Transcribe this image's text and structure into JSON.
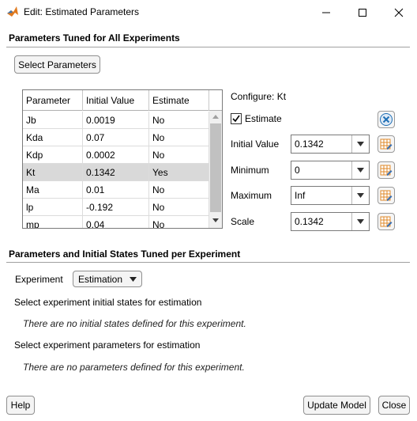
{
  "window": {
    "title": "Edit: Estimated Parameters"
  },
  "section1": {
    "title": "Parameters Tuned for All Experiments",
    "select_button": "Select Parameters",
    "table": {
      "headers": [
        "Parameter",
        "Initial Value",
        "Estimate"
      ],
      "rows": [
        {
          "param": "Jb",
          "value": "0.0019",
          "estimate": "No"
        },
        {
          "param": "Kda",
          "value": "0.07",
          "estimate": "No"
        },
        {
          "param": "Kdp",
          "value": "0.0002",
          "estimate": "No"
        },
        {
          "param": "Kt",
          "value": "0.1342",
          "estimate": "Yes"
        },
        {
          "param": "Ma",
          "value": "0.01",
          "estimate": "No"
        },
        {
          "param": "lp",
          "value": "-0.192",
          "estimate": "No"
        },
        {
          "param": "mp",
          "value": "0.04",
          "estimate": "No"
        }
      ],
      "selected_row": 3
    },
    "configure": {
      "label": "Configure: Kt",
      "estimate_label": "Estimate",
      "estimate_checked": true,
      "fields": [
        {
          "label": "Initial Value",
          "value": "0.1342"
        },
        {
          "label": "Minimum",
          "value": "0"
        },
        {
          "label": "Maximum",
          "value": "Inf"
        },
        {
          "label": "Scale",
          "value": "0.1342"
        }
      ]
    }
  },
  "section2": {
    "title": "Parameters and Initial States Tuned per Experiment",
    "experiment_label": "Experiment",
    "experiment_value": "Estimation",
    "states_heading": "Select experiment initial states for estimation",
    "states_empty": "There are no initial states defined for this experiment.",
    "params_heading": "Select experiment parameters for estimation",
    "params_empty": "There are no parameters defined for this experiment."
  },
  "footer": {
    "help": "Help",
    "update": "Update Model",
    "close": "Close"
  },
  "colors": {
    "selected_row": "#d9d9d9",
    "delete_icon": "#1f6fb5",
    "app_icon": "#e07a1f"
  }
}
